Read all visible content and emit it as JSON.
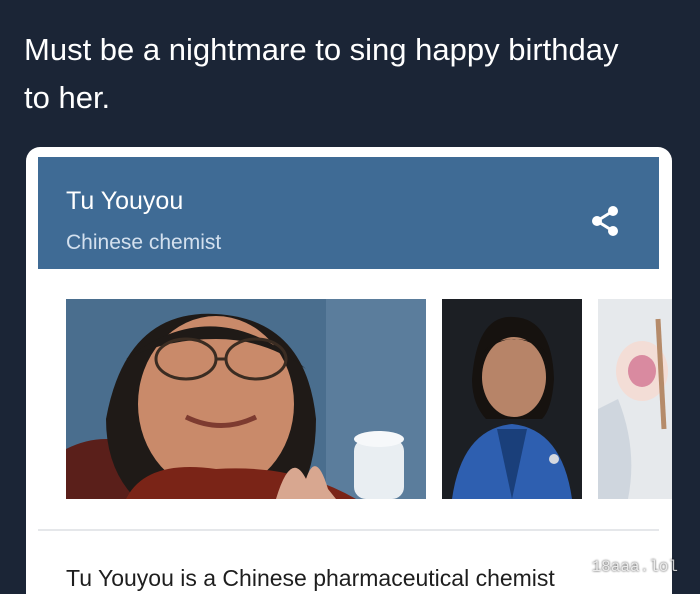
{
  "post": {
    "text": "Must be a nightmare to sing happy birthday to her."
  },
  "knowledge_card": {
    "title": "Tu Youyou",
    "subtitle": "Chinese chemist",
    "share_icon": "share-icon",
    "images": [
      {
        "depicts": "photo-portrait-smiling"
      },
      {
        "depicts": "photo-portrait-blue-jacket"
      },
      {
        "depicts": "photo-lab-partial"
      }
    ],
    "description": "Tu Youyou is a Chinese pharmaceutical chemist"
  },
  "watermark": "18aaa.lol",
  "colors": {
    "background": "#1b2536",
    "header": "#3f6b95",
    "card": "#ffffff"
  }
}
